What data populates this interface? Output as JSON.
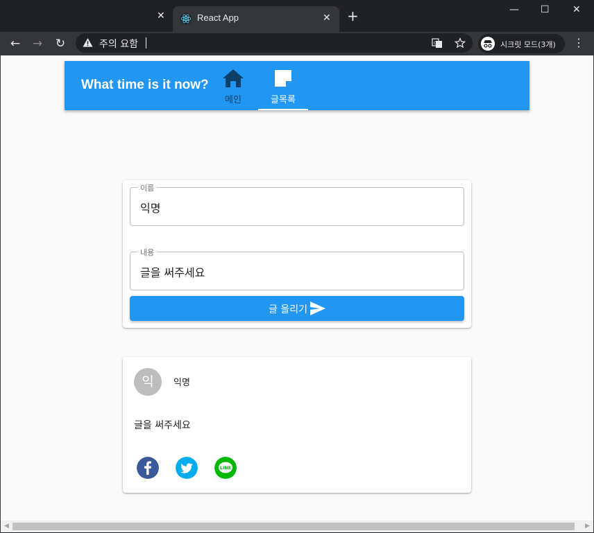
{
  "browser": {
    "active_tab_title": "React App",
    "url_text": "주의 요함",
    "incognito_label": "시크릿 모드(3개)",
    "tab_close_glyph": "✕",
    "new_tab_glyph": "+",
    "win_min": "—",
    "win_max": "☐",
    "win_close": "✕",
    "back_glyph": "←",
    "forward_glyph": "→",
    "reload_glyph": "↻",
    "menu_glyph": "⋮"
  },
  "appbar": {
    "title": "What time is it now?",
    "tabs": [
      {
        "label": "메인",
        "icon": "home-icon",
        "selected": false
      },
      {
        "label": "글목록",
        "icon": "note-icon",
        "selected": true
      }
    ]
  },
  "form": {
    "name_label": "이름",
    "name_value": "익명",
    "content_label": "내용",
    "content_value": "글을 써주세요",
    "submit_label": "글 올리기"
  },
  "post": {
    "avatar_initial": "익",
    "author": "익명",
    "body": "글을 써주세요",
    "share": [
      "facebook-icon",
      "twitter-icon",
      "line-icon"
    ]
  },
  "colors": {
    "primary": "#2196f3",
    "facebook": "#3b5998",
    "twitter": "#00aced",
    "line": "#00b800"
  }
}
